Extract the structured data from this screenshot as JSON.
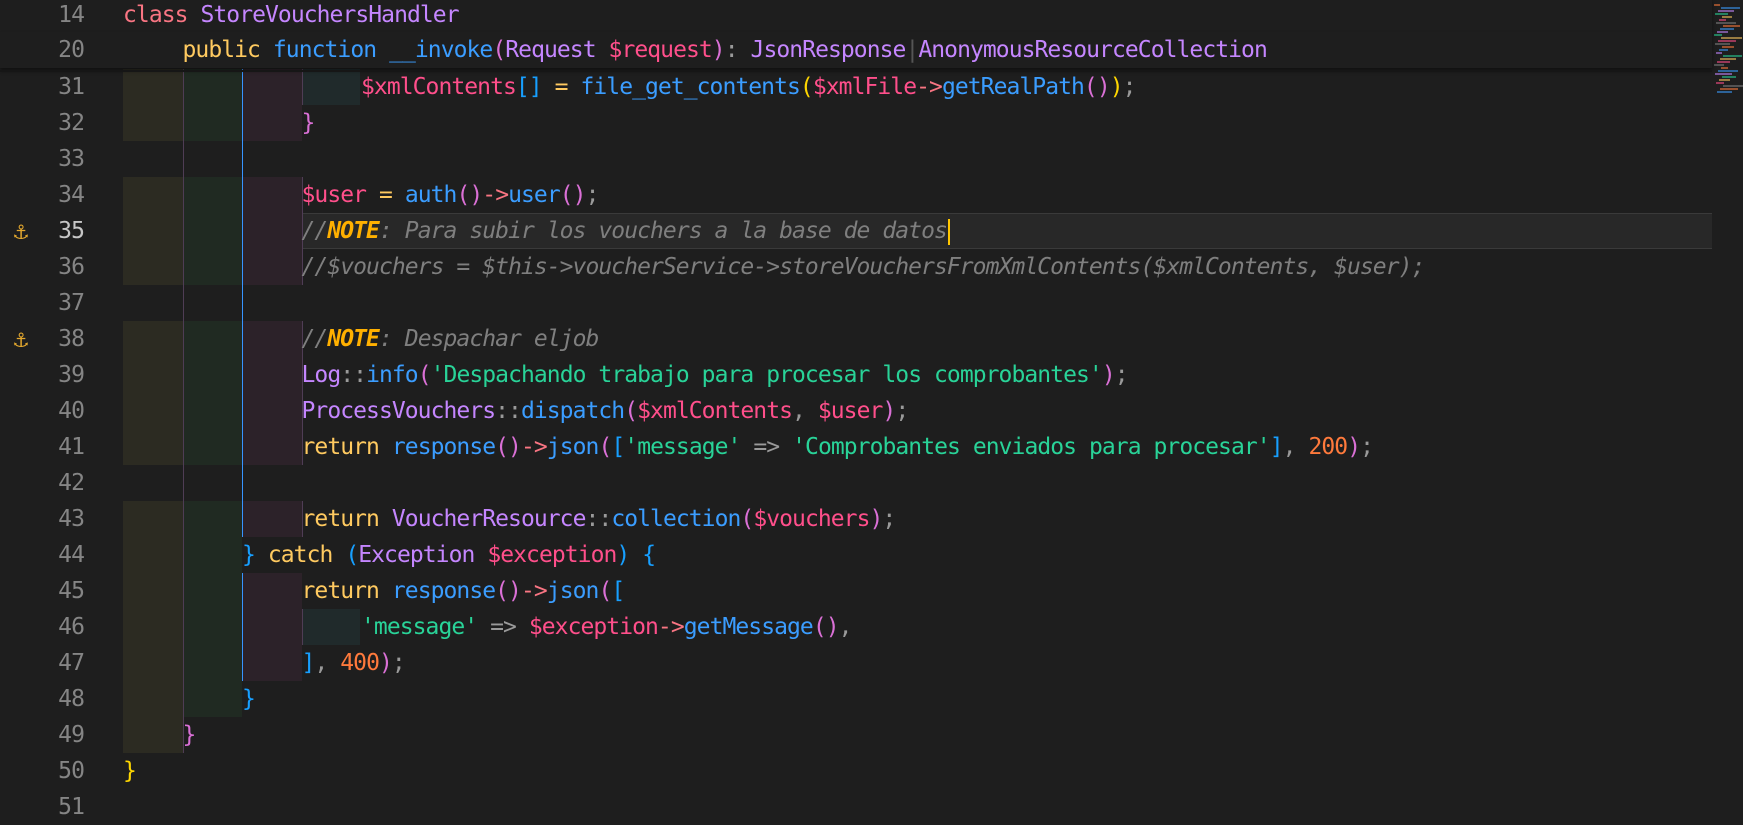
{
  "editor": {
    "language": "PHP",
    "current_line": 35,
    "icons": {
      "bookmark": "anchor-icon"
    },
    "colors": {
      "background": "#1e1e1e",
      "keyword": "#ffca60",
      "string": "#29d398",
      "function": "#3b9dff",
      "variable": "#ff4f8b",
      "class": "#c586ff",
      "number": "#ff7a3c",
      "comment": "#7f7f7f",
      "note_tag": "#ffb000",
      "bookmark": "#e2a72e",
      "cursor": "#ffc600"
    }
  },
  "sticky": [
    {
      "num": "14",
      "tokens": [
        [
          "kw2",
          "class"
        ],
        [
          "def",
          " "
        ],
        [
          "cl",
          "StoreVouchersHandler"
        ]
      ]
    },
    {
      "num": "20",
      "tokens": [
        [
          "kw",
          "public"
        ],
        [
          "def",
          " "
        ],
        [
          "fn",
          "function"
        ],
        [
          "def",
          " "
        ],
        [
          "magic",
          "__invoke"
        ],
        [
          "br2",
          "("
        ],
        [
          "cl",
          "Request"
        ],
        [
          "def",
          " "
        ],
        [
          "var",
          "$request"
        ],
        [
          "br2",
          ")"
        ],
        [
          "pu",
          ": "
        ],
        [
          "cl",
          "JsonResponse"
        ],
        [
          "sep",
          "|"
        ],
        [
          "cl",
          "AnonymousResourceCollection"
        ]
      ]
    }
  ],
  "lines": [
    {
      "num": "31",
      "tokens": [
        [
          "var",
          "$xmlContents"
        ],
        [
          "br3",
          "[]"
        ],
        [
          "def",
          " "
        ],
        [
          "kw",
          "="
        ],
        [
          "def",
          " "
        ],
        [
          "fn",
          "file_get_contents"
        ],
        [
          "br",
          "("
        ],
        [
          "var",
          "$xmlFile"
        ],
        [
          "kw2",
          "->"
        ],
        [
          "fn",
          "getRealPath"
        ],
        [
          "br2",
          "()"
        ],
        [
          "br",
          ")"
        ],
        [
          "pu",
          ";"
        ]
      ]
    },
    {
      "num": "32",
      "tokens": [
        [
          "br2",
          "}"
        ]
      ]
    },
    {
      "num": "33",
      "tokens": []
    },
    {
      "num": "34",
      "tokens": [
        [
          "var",
          "$user"
        ],
        [
          "def",
          " "
        ],
        [
          "kw",
          "="
        ],
        [
          "def",
          " "
        ],
        [
          "fn",
          "auth"
        ],
        [
          "br2",
          "()"
        ],
        [
          "kw2",
          "->"
        ],
        [
          "fn",
          "user"
        ],
        [
          "br2",
          "()"
        ],
        [
          "pu",
          ";"
        ]
      ]
    },
    {
      "num": "35",
      "tokens": [
        [
          "cm",
          "//"
        ],
        [
          "note",
          "NOTE"
        ],
        [
          "cm",
          ": Para subir los vouchers a la base de datos"
        ]
      ]
    },
    {
      "num": "36",
      "tokens": [
        [
          "cm",
          "//$vouchers = $this->voucherService->storeVouchersFromXmlContents($xmlContents, $user);"
        ]
      ]
    },
    {
      "num": "37",
      "tokens": []
    },
    {
      "num": "38",
      "tokens": [
        [
          "cm",
          "//"
        ],
        [
          "note",
          "NOTE"
        ],
        [
          "cm",
          ": Despachar eljob"
        ]
      ]
    },
    {
      "num": "39",
      "tokens": [
        [
          "cl",
          "Log"
        ],
        [
          "pu",
          "::"
        ],
        [
          "fn",
          "info"
        ],
        [
          "br2",
          "("
        ],
        [
          "str",
          "'Despachando trabajo para procesar los comprobantes'"
        ],
        [
          "br2",
          ")"
        ],
        [
          "pu",
          ";"
        ]
      ]
    },
    {
      "num": "40",
      "tokens": [
        [
          "cl",
          "ProcessVouchers"
        ],
        [
          "pu",
          "::"
        ],
        [
          "fn",
          "dispatch"
        ],
        [
          "br2",
          "("
        ],
        [
          "var",
          "$xmlContents"
        ],
        [
          "pu",
          ", "
        ],
        [
          "var",
          "$user"
        ],
        [
          "br2",
          ")"
        ],
        [
          "pu",
          ";"
        ]
      ]
    },
    {
      "num": "41",
      "tokens": [
        [
          "kw",
          "return"
        ],
        [
          "def",
          " "
        ],
        [
          "fn",
          "response"
        ],
        [
          "br2",
          "()"
        ],
        [
          "kw2",
          "->"
        ],
        [
          "fn",
          "json"
        ],
        [
          "br2",
          "("
        ],
        [
          "br3",
          "["
        ],
        [
          "str",
          "'message'"
        ],
        [
          "def",
          " "
        ],
        [
          "pu",
          "=>"
        ],
        [
          "def",
          " "
        ],
        [
          "str",
          "'Comprobantes enviados para procesar'"
        ],
        [
          "br3",
          "]"
        ],
        [
          "pu",
          ", "
        ],
        [
          "num",
          "200"
        ],
        [
          "br2",
          ")"
        ],
        [
          "pu",
          ";"
        ]
      ]
    },
    {
      "num": "42",
      "tokens": []
    },
    {
      "num": "43",
      "tokens": [
        [
          "kw",
          "return"
        ],
        [
          "def",
          " "
        ],
        [
          "cl",
          "VoucherResource"
        ],
        [
          "pu",
          "::"
        ],
        [
          "fn",
          "collection"
        ],
        [
          "br2",
          "("
        ],
        [
          "var",
          "$vouchers"
        ],
        [
          "br2",
          ")"
        ],
        [
          "pu",
          ";"
        ]
      ]
    },
    {
      "num": "44",
      "tokens": [
        [
          "br3",
          "}"
        ],
        [
          "def",
          " "
        ],
        [
          "kw",
          "catch"
        ],
        [
          "def",
          " "
        ],
        [
          "br3",
          "("
        ],
        [
          "cl",
          "Exception"
        ],
        [
          "def",
          " "
        ],
        [
          "var",
          "$exception"
        ],
        [
          "br3",
          ")"
        ],
        [
          "def",
          " "
        ],
        [
          "br3",
          "{"
        ]
      ]
    },
    {
      "num": "45",
      "tokens": [
        [
          "kw",
          "return"
        ],
        [
          "def",
          " "
        ],
        [
          "fn",
          "response"
        ],
        [
          "br2",
          "()"
        ],
        [
          "kw2",
          "->"
        ],
        [
          "fn",
          "json"
        ],
        [
          "br2",
          "("
        ],
        [
          "br3",
          "["
        ]
      ]
    },
    {
      "num": "46",
      "tokens": [
        [
          "str",
          "'message'"
        ],
        [
          "def",
          " "
        ],
        [
          "pu",
          "=>"
        ],
        [
          "def",
          " "
        ],
        [
          "var",
          "$exception"
        ],
        [
          "kw2",
          "->"
        ],
        [
          "fn",
          "getMessage"
        ],
        [
          "br2",
          "()"
        ],
        [
          "pu",
          ","
        ]
      ]
    },
    {
      "num": "47",
      "tokens": [
        [
          "br3",
          "]"
        ],
        [
          "pu",
          ", "
        ],
        [
          "num",
          "400"
        ],
        [
          "br2",
          ")"
        ],
        [
          "pu",
          ";"
        ]
      ]
    },
    {
      "num": "48",
      "tokens": [
        [
          "br3",
          "}"
        ]
      ]
    },
    {
      "num": "49",
      "tokens": [
        [
          "br2",
          "}"
        ]
      ]
    },
    {
      "num": "50",
      "tokens": [
        [
          "br",
          "}"
        ]
      ]
    },
    {
      "num": "51",
      "tokens": []
    }
  ]
}
